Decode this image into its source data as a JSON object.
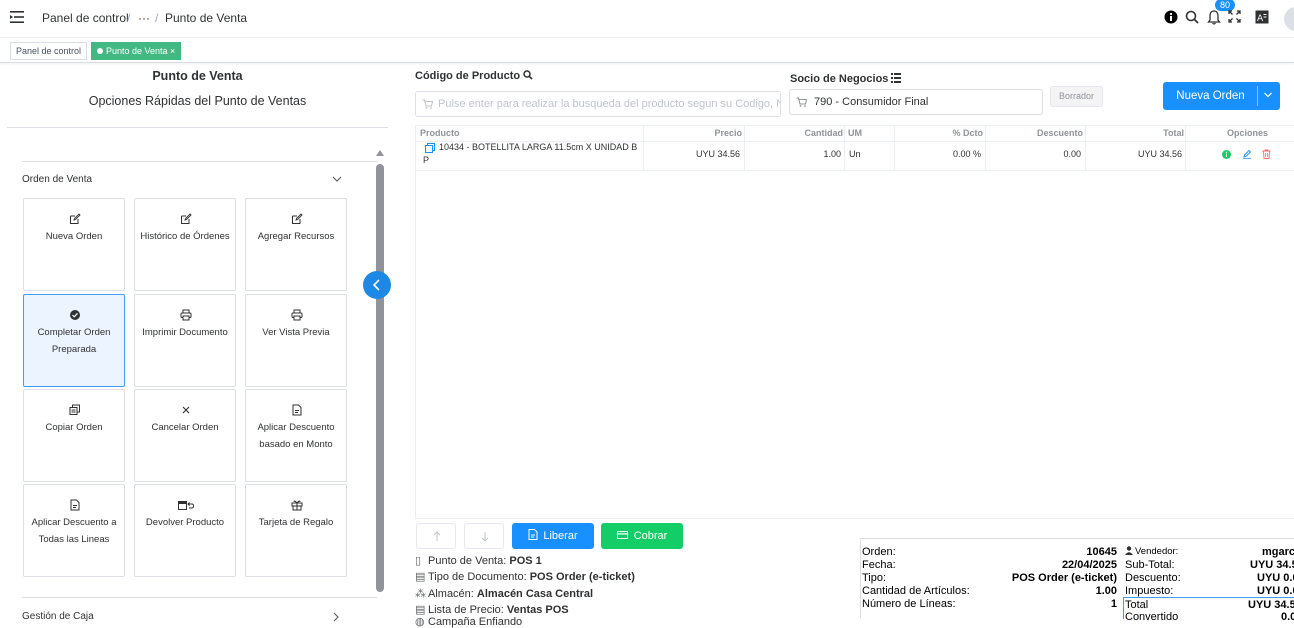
{
  "topbar": {
    "breadcrumb": [
      "Panel de control",
      "···",
      "Punto de Venta"
    ],
    "notifications_count": "80"
  },
  "tags": {
    "items": [
      "Panel de control",
      "Punto de Venta ×"
    ]
  },
  "left": {
    "title": "Punto de Venta",
    "subtitle": "Opciones Rápidas del Punto de Ventas",
    "group1": "Orden de Venta",
    "group2": "Gestión de Caja",
    "actions": [
      {
        "label": "Nueva Orden",
        "icon": "edit-icon"
      },
      {
        "label": "Histórico de Órdenes",
        "icon": "edit-icon"
      },
      {
        "label": "Agregar Recursos",
        "icon": "edit-icon"
      },
      {
        "label": "Completar Orden Preparada",
        "icon": "check-circle-icon"
      },
      {
        "label": "Imprimir Documento",
        "icon": "printer-icon"
      },
      {
        "label": "Ver Vista Previa",
        "icon": "printer-icon"
      },
      {
        "label": "Copiar Orden",
        "icon": "copy-icon"
      },
      {
        "label": "Cancelar Orden",
        "icon": "close-icon"
      },
      {
        "label": "Aplicar Descuento basado en Monto",
        "icon": "document-icon"
      },
      {
        "label": "Aplicar Descuento a Todas las Lineas",
        "icon": "document-icon"
      },
      {
        "label": "Devolver Producto",
        "icon": "return-icon"
      },
      {
        "label": "Tarjeta de Regalo",
        "icon": "gift-icon"
      }
    ]
  },
  "main": {
    "product_label": "Código de Producto",
    "product_placeholder": "Pulse enter para realizar la busqueda del producto segun su Codigo, N",
    "partner_label": "Socio de Negocios",
    "partner_value": "790 - Consumidor Final",
    "draft_button": "Borrador",
    "new_order_button": "Nueva Orden",
    "table": {
      "headers": [
        "Producto",
        "Precio",
        "Cantidad",
        "UM",
        "% Dcto",
        "Descuento",
        "Total",
        "Opciones"
      ],
      "rows": [
        {
          "product_line1": "10434 - BOTELLITA LARGA 11.5cm X UNIDAD B",
          "product_line2": "P",
          "price": "UYU 34.56",
          "qty": "1.00",
          "um": "Un",
          "dcto": "0.00 %",
          "discount": "0.00",
          "total": "UYU 34.56"
        }
      ]
    },
    "release_button": "Liberar",
    "charge_button": "Cobrar",
    "info": {
      "pos_label": "Punto de Venta:",
      "pos_value": "POS 1",
      "doctype_label": "Tipo de Documento:",
      "doctype_value": "POS Order (e-ticket)",
      "warehouse_label": "Almacén:",
      "warehouse_value": "Almacén Casa Central",
      "pricelist_label": "Lista de Precio:",
      "pricelist_value": "Ventas POS",
      "extra_label": "Campaña Enfiando"
    },
    "summary": {
      "order_label": "Orden:",
      "order_value": "10645",
      "date_label": "Fecha:",
      "date_value": "22/04/2025",
      "type_label": "Tipo:",
      "type_value": "POS Order (e-ticket)",
      "items_label": "Cantidad de Artículos:",
      "items_value": "1.00",
      "lines_label": "Número de Líneas:",
      "lines_value": "1",
      "seller_label": "Vendedor:",
      "seller_value": "mgarc",
      "subtotal_label": "Sub-Total:",
      "subtotal_value": "UYU 34.5",
      "discount_label": "Descuento:",
      "discount_value": "UYU 0.0",
      "tax_label": "Impuesto:",
      "tax_value": "UYU 0.0",
      "total_label": "Total",
      "total_value": "UYU 34.5",
      "converted_label": "Convertido",
      "converted_value": "0.0"
    }
  }
}
